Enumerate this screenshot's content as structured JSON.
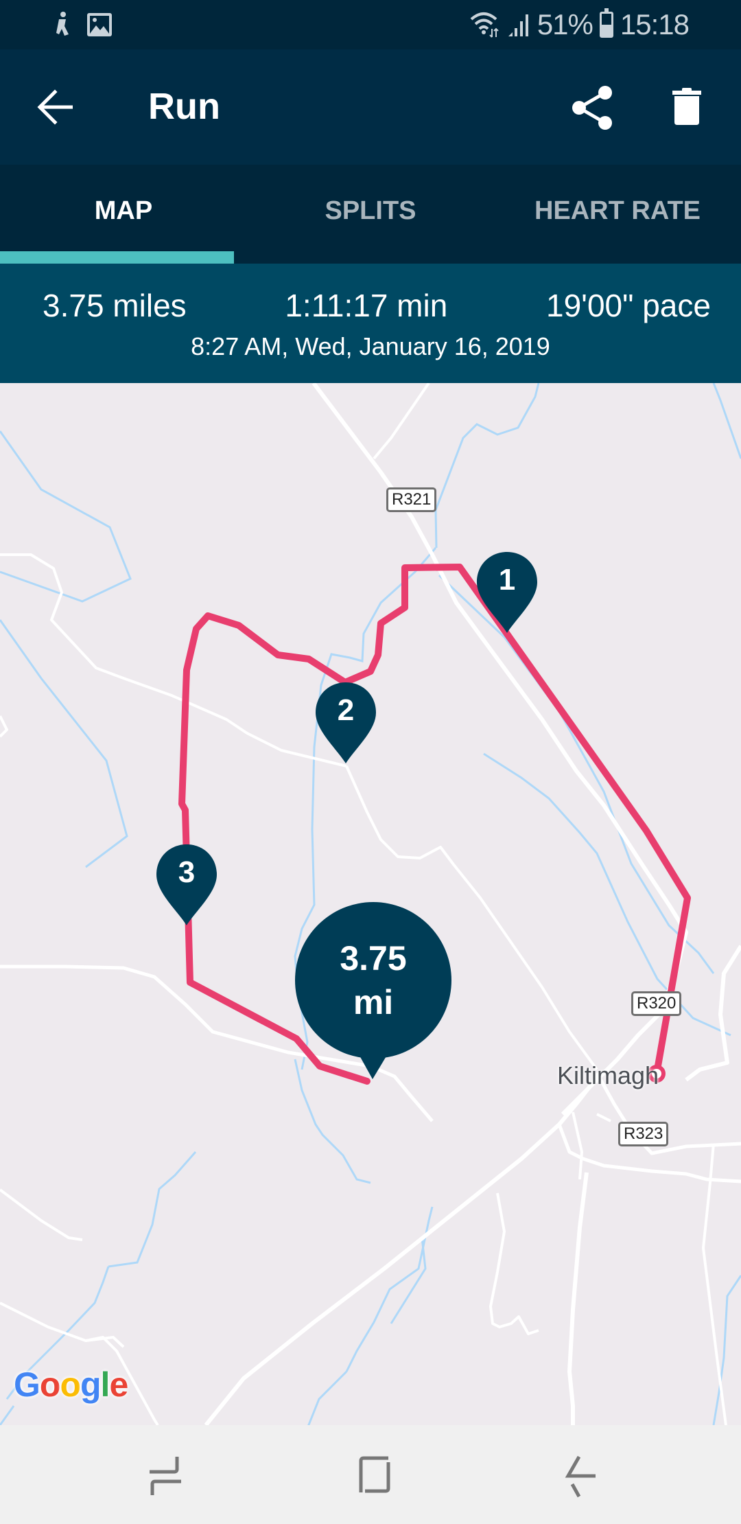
{
  "status_bar": {
    "left_icons": [
      "accessibility-notification-icon",
      "image-notification-icon"
    ],
    "right_icons": [
      "wifi-icon",
      "signal-icon",
      "battery-icon"
    ],
    "battery_percent_label": "51%",
    "battery_level": 0.51,
    "time": "15:18"
  },
  "app_bar": {
    "back_icon": "arrow-back-icon",
    "title": "Run",
    "share_icon": "share-icon",
    "delete_icon": "trash-icon"
  },
  "tabs": [
    {
      "label": "MAP",
      "active": true
    },
    {
      "label": "SPLITS",
      "active": false
    },
    {
      "label": "HEART RATE",
      "active": false
    }
  ],
  "summary": {
    "distance": "3.75 miles",
    "duration": "1:11:17 min",
    "pace": "19'00\" pace",
    "datetime": "8:27 AM, Wed, January 16, 2019"
  },
  "map": {
    "road_labels": [
      "R321",
      "R320",
      "R323"
    ],
    "place_label": "Kiltimagh",
    "split_markers": [
      "1",
      "2",
      "3"
    ],
    "finish_marker": {
      "value": "3.75",
      "unit": "mi"
    },
    "attribution": "Google",
    "colors": {
      "route": "#e83e6e",
      "marker": "#003d56",
      "water": "#aed8f8",
      "road": "#ffffff",
      "land": "#eeeaee"
    }
  },
  "nav_bar": {
    "recents_icon": "recent-apps-icon",
    "home_icon": "home-icon",
    "back_icon": "back-icon"
  },
  "colors": {
    "status_bg": "#00263b",
    "appbar_bg": "#002c45",
    "tabs_bg": "#00263b",
    "tab_indicator": "#4dc0c0",
    "summary_bg": "#004963"
  }
}
